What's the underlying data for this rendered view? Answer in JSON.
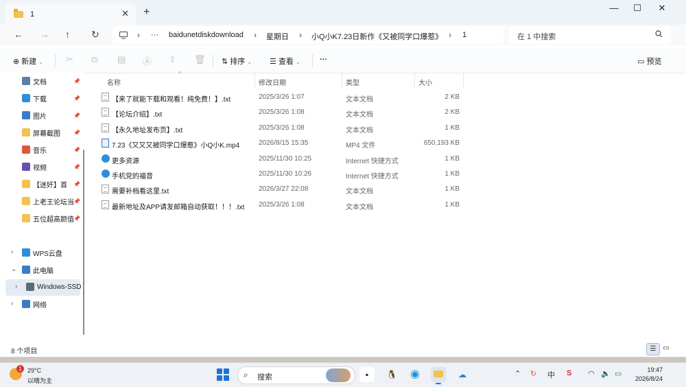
{
  "window": {
    "tab_title": "1",
    "tab_close": "✕",
    "new_tab": "+",
    "min": "—",
    "max": "☐",
    "close": "✕"
  },
  "address": {
    "more": "···",
    "crumbs": [
      "baidunetdiskdownload",
      "星期日",
      "小Q小K7.23日新作《又被同学口爆惹》",
      "1"
    ],
    "search_placeholder": "在 1 中搜索"
  },
  "toolbar": {
    "new_label": "新建",
    "sort_label": "排序",
    "view_label": "查看",
    "more": "···",
    "preview_label": "预览"
  },
  "sidebar": {
    "quick": [
      {
        "label": "文档",
        "color": "#5a7ea8"
      },
      {
        "label": "下载",
        "color": "#2f8ddb"
      },
      {
        "label": "图片",
        "color": "#3a7cc5"
      },
      {
        "label": "屏幕截图",
        "color": "#f2c14e"
      },
      {
        "label": "音乐",
        "color": "#e0553d"
      },
      {
        "label": "视频",
        "color": "#6a4fb3"
      },
      {
        "label": "【迷奸】首",
        "color": "#f2c14e"
      },
      {
        "label": "上老王论坛当",
        "color": "#f2c14e"
      },
      {
        "label": "五位超高颜值",
        "color": "#f2c14e"
      }
    ],
    "tree": [
      {
        "label": "WPS云盘",
        "chev": "›"
      },
      {
        "label": "此电脑",
        "chev": "⌄"
      },
      {
        "label": "Windows-SSD",
        "chev": "›"
      },
      {
        "label": "网络",
        "chev": "›"
      }
    ]
  },
  "columns": {
    "name": "名称",
    "date": "修改日期",
    "type": "类型",
    "size": "大小"
  },
  "files": [
    {
      "name": "【来了就能下载和观看！纯免费！】.txt",
      "date": "2025/3/26 1:07",
      "type": "文本文档",
      "size": "2 KB",
      "icon": "txt"
    },
    {
      "name": "【论坛介绍】.txt",
      "date": "2025/3/26 1:08",
      "type": "文本文档",
      "size": "2 KB",
      "icon": "txt"
    },
    {
      "name": "【永久地址发布页】.txt",
      "date": "2025/3/26 1:08",
      "type": "文本文档",
      "size": "1 KB",
      "icon": "txt"
    },
    {
      "name": "7.23《又又又被同学口爆惹》小Q小K.mp4",
      "date": "2026/8/15 15:35",
      "type": "MP4 文件",
      "size": "650,193 KB",
      "icon": "mp4"
    },
    {
      "name": "更多资源",
      "date": "2025/11/30 10:25",
      "type": "Internet 快捷方式",
      "size": "1 KB",
      "icon": "url"
    },
    {
      "name": "手机党的福音",
      "date": "2025/11/30 10:26",
      "type": "Internet 快捷方式",
      "size": "1 KB",
      "icon": "url"
    },
    {
      "name": "需要补档看这里.txt",
      "date": "2026/3/27 22:08",
      "type": "文本文档",
      "size": "1 KB",
      "icon": "txt"
    },
    {
      "name": "最新地址及APP请发邮箱自动获取！！！.txt",
      "date": "2025/3/26 1:08",
      "type": "文本文档",
      "size": "1 KB",
      "icon": "txt"
    }
  ],
  "status": {
    "count": "8 个项目"
  },
  "taskbar": {
    "weather_badge": "1",
    "temp": "29°C",
    "weather_desc": "以晴为主",
    "search_placeholder": "搜索",
    "ime": "中",
    "time": "19:47",
    "date": "2026/8/24"
  }
}
